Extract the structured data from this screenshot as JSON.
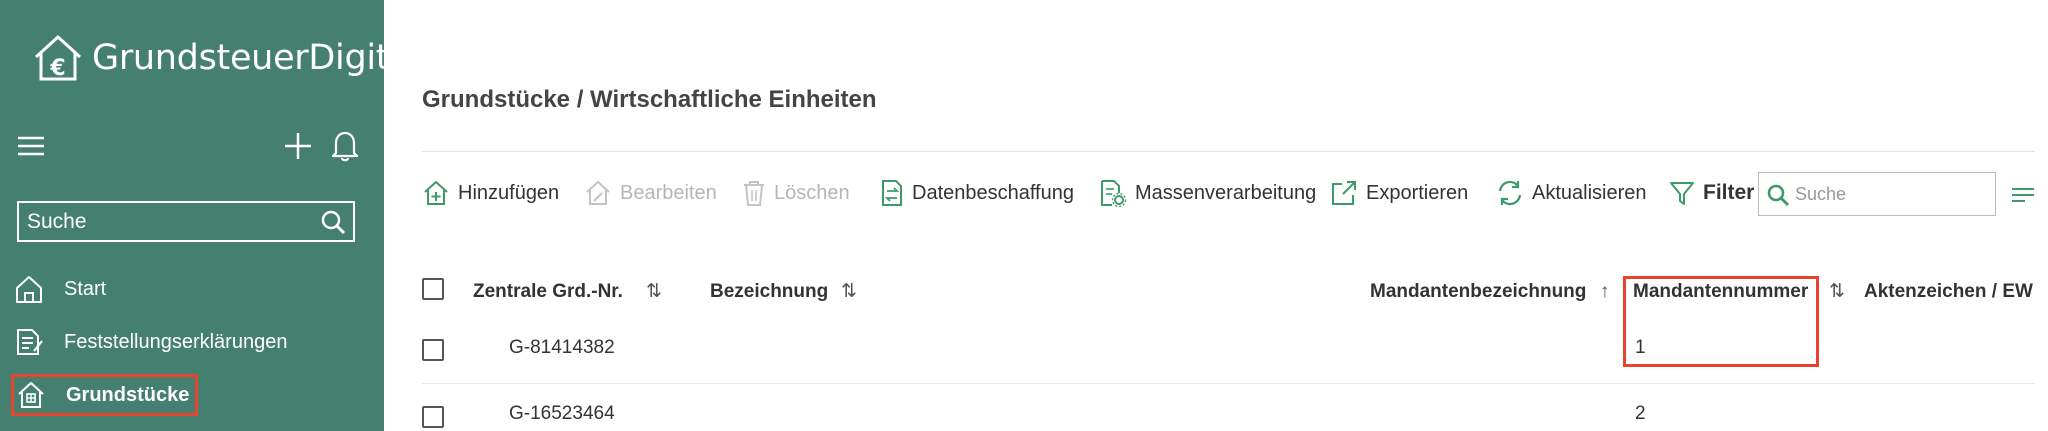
{
  "app": {
    "brand": "GrundsteuerDigital"
  },
  "sidebar": {
    "search_placeholder": "Suche",
    "items": [
      {
        "label": "Start",
        "icon": "home-icon",
        "active": false
      },
      {
        "label": "Feststellungserklärungen",
        "icon": "document-edit-icon",
        "active": false
      },
      {
        "label": "Grundstücke",
        "icon": "building-icon",
        "active": true
      }
    ]
  },
  "main": {
    "title": "Grundstücke / Wirtschaftliche Einheiten",
    "toolbar": {
      "add": "Hinzufügen",
      "edit": "Bearbeiten",
      "delete": "Löschen",
      "data_procurement": "Datenbeschaffung",
      "mass_processing": "Massenverarbeitung",
      "export": "Exportieren",
      "refresh": "Aktualisieren",
      "filter": "Filter",
      "search_placeholder": "Suche"
    },
    "table": {
      "columns": [
        {
          "label": "Zentrale Grd.-Nr.",
          "sort": "⇅"
        },
        {
          "label": "Bezeichnung",
          "sort": "⇅"
        },
        {
          "label": "Mandantenbezeichnung",
          "sort": "↑"
        },
        {
          "label": "Mandantennummer",
          "sort": "⇅"
        },
        {
          "label": "Aktenzeichen / EW",
          "sort": ""
        }
      ],
      "rows": [
        {
          "grd_nr": "G-81414382",
          "bezeichnung": "",
          "mandantenbezeichnung": "",
          "mandantennummer": "1",
          "aktenzeichen": ""
        },
        {
          "grd_nr": "G-16523464",
          "bezeichnung": "",
          "mandantenbezeichnung": "",
          "mandantennummer": "2",
          "aktenzeichen": ""
        }
      ]
    }
  },
  "colors": {
    "sidebar": "#457f70",
    "accent_green": "#3d9a6a",
    "highlight": "#e8432e"
  }
}
